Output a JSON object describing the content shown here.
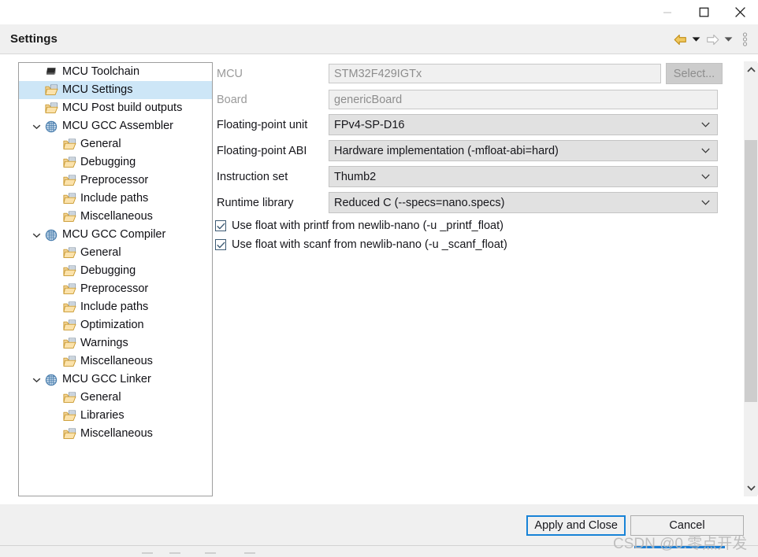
{
  "window": {
    "controls": [
      {
        "name": "minimize",
        "glyph": "minimize-icon"
      },
      {
        "name": "maximize",
        "glyph": "maximize-icon"
      },
      {
        "name": "close",
        "glyph": "close-icon"
      }
    ]
  },
  "header": {
    "title": "Settings",
    "tools": [
      {
        "name": "back-navigation-icon",
        "enabled": true
      },
      {
        "name": "back-dropdown-caret-icon",
        "enabled": true
      },
      {
        "name": "forward-navigation-icon",
        "enabled": false
      },
      {
        "name": "forward-dropdown-caret-icon",
        "enabled": true
      },
      {
        "name": "view-menu-icon",
        "enabled": true
      }
    ]
  },
  "tree": {
    "selected": "MCU Settings",
    "items": [
      {
        "label": "MCU Toolchain",
        "indent": 0,
        "icon": "chip-icon",
        "twisty": "none"
      },
      {
        "label": "MCU Settings",
        "indent": 0,
        "icon": "folder-icon",
        "twisty": "none",
        "selected": true
      },
      {
        "label": "MCU Post build outputs",
        "indent": 0,
        "icon": "folder-icon",
        "twisty": "none"
      },
      {
        "label": "MCU GCC Assembler",
        "indent": 0,
        "icon": "gear-disc-icon",
        "twisty": "expanded"
      },
      {
        "label": "General",
        "indent": 1,
        "icon": "folder-icon",
        "twisty": "none"
      },
      {
        "label": "Debugging",
        "indent": 1,
        "icon": "folder-icon",
        "twisty": "none"
      },
      {
        "label": "Preprocessor",
        "indent": 1,
        "icon": "folder-icon",
        "twisty": "none"
      },
      {
        "label": "Include paths",
        "indent": 1,
        "icon": "folder-icon",
        "twisty": "none"
      },
      {
        "label": "Miscellaneous",
        "indent": 1,
        "icon": "folder-icon",
        "twisty": "none"
      },
      {
        "label": "MCU GCC Compiler",
        "indent": 0,
        "icon": "gear-disc-icon",
        "twisty": "expanded"
      },
      {
        "label": "General",
        "indent": 1,
        "icon": "folder-icon",
        "twisty": "none"
      },
      {
        "label": "Debugging",
        "indent": 1,
        "icon": "folder-icon",
        "twisty": "none"
      },
      {
        "label": "Preprocessor",
        "indent": 1,
        "icon": "folder-icon",
        "twisty": "none"
      },
      {
        "label": "Include paths",
        "indent": 1,
        "icon": "folder-icon",
        "twisty": "none"
      },
      {
        "label": "Optimization",
        "indent": 1,
        "icon": "folder-icon",
        "twisty": "none"
      },
      {
        "label": "Warnings",
        "indent": 1,
        "icon": "folder-icon",
        "twisty": "none"
      },
      {
        "label": "Miscellaneous",
        "indent": 1,
        "icon": "folder-icon",
        "twisty": "none"
      },
      {
        "label": "MCU GCC Linker",
        "indent": 0,
        "icon": "gear-disc-icon",
        "twisty": "expanded"
      },
      {
        "label": "General",
        "indent": 1,
        "icon": "folder-icon",
        "twisty": "none"
      },
      {
        "label": "Libraries",
        "indent": 1,
        "icon": "folder-icon",
        "twisty": "none"
      },
      {
        "label": "Miscellaneous",
        "indent": 1,
        "icon": "folder-icon",
        "twisty": "none"
      }
    ]
  },
  "form": {
    "mcu": {
      "label": "MCU",
      "value": "STM32F429IGTx",
      "placeholder": "",
      "disabled": true,
      "button_label": "Select..."
    },
    "board": {
      "label": "Board",
      "value": "genericBoard",
      "placeholder": "",
      "disabled": true
    },
    "fpu": {
      "label": "Floating-point unit",
      "value": "FPv4-SP-D16"
    },
    "fp_abi": {
      "label": "Floating-point ABI",
      "value": "Hardware implementation (-mfloat-abi=hard)"
    },
    "instruction_set": {
      "label": "Instruction set",
      "value": "Thumb2"
    },
    "runtime_library": {
      "label": "Runtime library",
      "value": "Reduced C (--specs=nano.specs)"
    },
    "printf_float": {
      "label": "Use float with printf from newlib-nano (-u _printf_float)",
      "checked": true
    },
    "scanf_float": {
      "label": "Use float with scanf from newlib-nano (-u _scanf_float)",
      "checked": true
    }
  },
  "footer": {
    "apply_label": "Apply and Close",
    "cancel_label": "Cancel"
  },
  "watermark": "CSDN @0.零点开发",
  "colors": {
    "selection": "#cde6f7",
    "focus_border": "#1883d7",
    "header_bg": "#f0f0f0",
    "disabled_text": "#8d8d8d",
    "back_arrow": "#e0a212"
  }
}
